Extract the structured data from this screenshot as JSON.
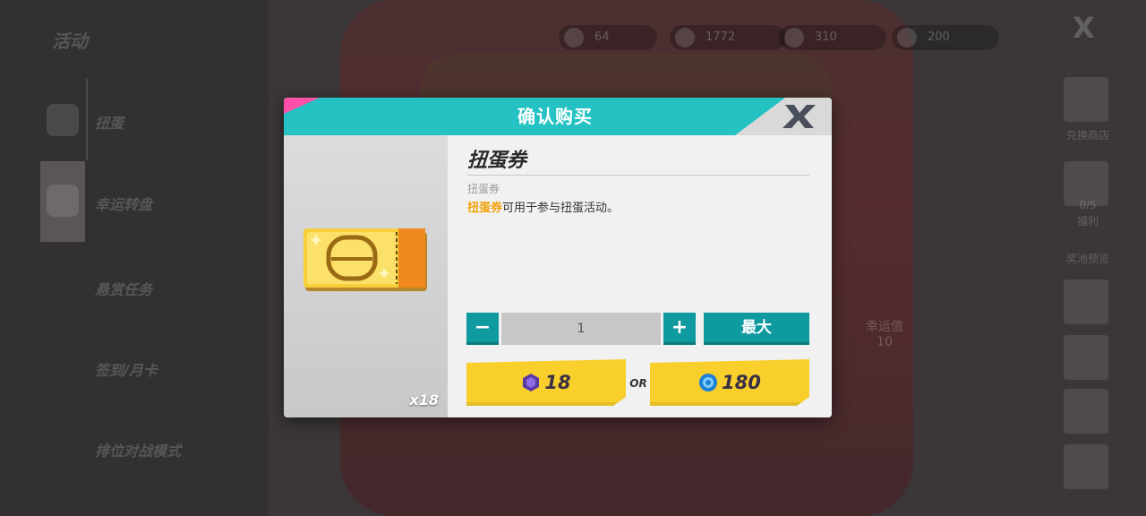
{
  "background": {
    "sidebar": {
      "title": "活动",
      "items": [
        {
          "label": "扭蛋"
        },
        {
          "label": "幸运转盘"
        },
        {
          "label": "悬赏任务"
        },
        {
          "label": "签到/月卡"
        },
        {
          "label": "排位对战模式"
        }
      ]
    },
    "currencies": [
      {
        "icon": "coin-icon",
        "value": "64"
      },
      {
        "icon": "face-token-icon",
        "value": "1772"
      },
      {
        "icon": "blue-gem-icon",
        "value": "310"
      },
      {
        "icon": "ticket-icon",
        "value": "200"
      }
    ],
    "close_glyph": "X",
    "right": {
      "shop_label": "兑换商店",
      "gift_label1": "0/5",
      "gift_label2": "福利",
      "pool_label": "奖池预览"
    },
    "luck": {
      "label": "幸运值",
      "value": "10"
    }
  },
  "dialog": {
    "title": "确认购买",
    "close_icon": "close-x-icon",
    "item": {
      "name": "扭蛋券",
      "type": "扭蛋券",
      "desc_highlight": "扭蛋券",
      "desc_rest": "可用于参与扭蛋活动。",
      "count": "x18",
      "icon": "gacha-ticket-icon"
    },
    "quantity": {
      "minus": "−",
      "value": "1",
      "plus": "+",
      "max_label": "最大"
    },
    "prices": [
      {
        "icon": "purple-crystal-icon",
        "value": "18"
      },
      {
        "icon": "blue-coin-icon",
        "value": "180"
      }
    ],
    "or_label": "OR"
  },
  "colors": {
    "teal": "#24c2c2",
    "button_teal": "#0f9aa0",
    "yellow": "#f9cf2c",
    "pink": "#ff4fa6",
    "highlight": "#f2a20b"
  }
}
